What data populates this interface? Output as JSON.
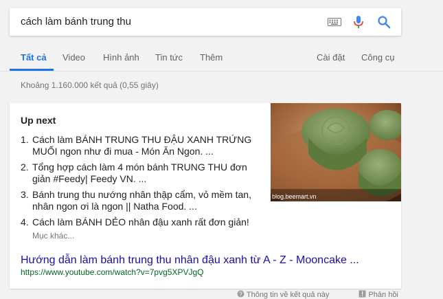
{
  "search": {
    "query": "cách làm bánh trung thu"
  },
  "tabs": [
    {
      "label": "Tất cả"
    },
    {
      "label": "Video"
    },
    {
      "label": "Hình ảnh"
    },
    {
      "label": "Tin tức"
    },
    {
      "label": "Thêm"
    },
    {
      "label": "Cài đặt"
    },
    {
      "label": "Công cụ"
    }
  ],
  "stats": "Khoảng 1.160.000 kết quả (0,55 giây)",
  "card": {
    "heading": "Up next",
    "items": [
      {
        "num": "1.",
        "text": "Cách làm BÁNH TRUNG THU ĐẬU XANH TRỨNG MUỐI ngon như đi mua - Món Ăn Ngon. ..."
      },
      {
        "num": "2.",
        "text": "Tổng hợp cách làm 4 món bánh TRUNG THU đơn giản #Feedy| Feedy VN. ..."
      },
      {
        "num": "3.",
        "text": "Bánh trung thu nướng nhân thập cẩm, vỏ mềm tan, nhân ngon ơi là ngon || Natha Food. ..."
      },
      {
        "num": "4.",
        "text": "Cách làm BÁNH DẺO nhân đậu xanh rất đơn giản!"
      }
    ],
    "more": "Mục khác...",
    "image_caption": "blog.beemart.vn",
    "result_title": "Hướng dẫn làm bánh trung thu nhân đậu xanh từ A - Z - Mooncake ...",
    "result_url": "https://www.youtube.com/watch?v=7pvg5XPVJgQ"
  },
  "footer": {
    "about": "Thông tin về kết quả này",
    "feedback": "Phản hồi"
  },
  "colors": {
    "accent": "#1a73e8",
    "link": "#1a0dab",
    "url": "#006621"
  }
}
